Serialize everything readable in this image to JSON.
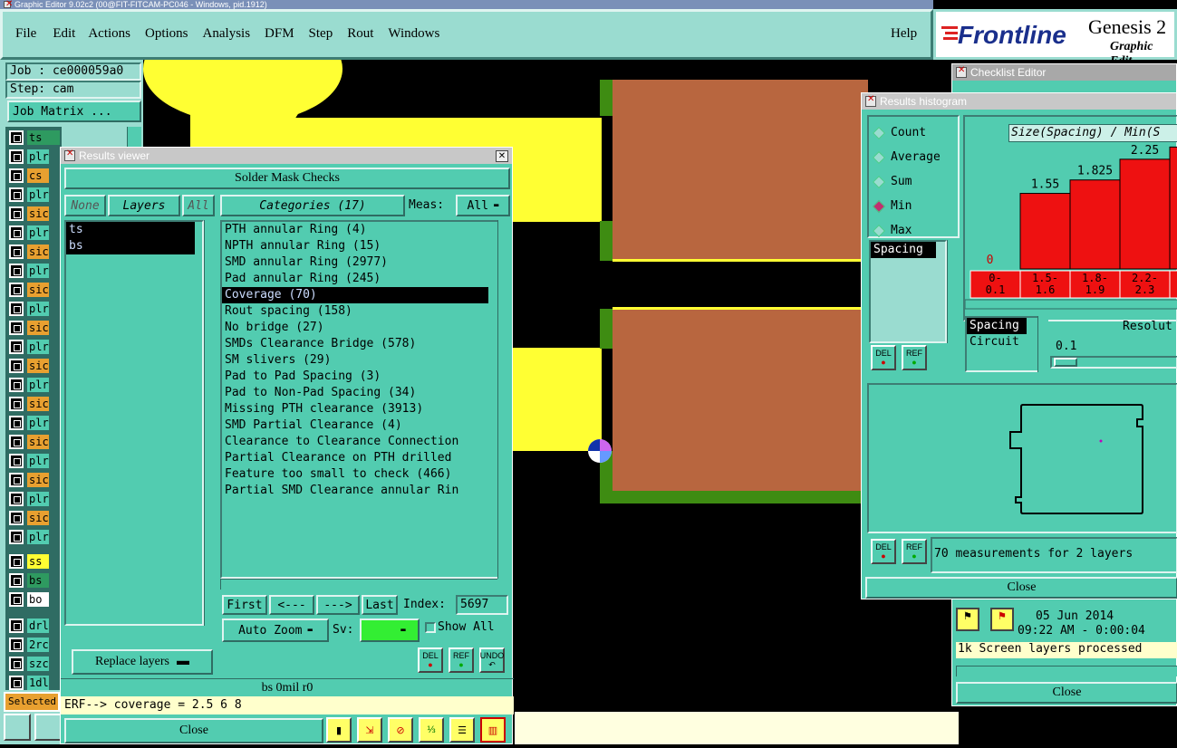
{
  "app": {
    "title": "Graphic Editor 9.02c2 (00@FIT-FITCAM-PC046 - Windows, pid.1912)",
    "brand": "Frontline",
    "brand_title": "Genesis 2",
    "brand_sub": "Graphic Edit"
  },
  "menu": [
    "File",
    "Edit",
    "Actions",
    "Options",
    "Analysis",
    "DFM",
    "Step",
    "Rout",
    "Windows"
  ],
  "help_label": "Help",
  "job": {
    "job_label": "Job : ce000059a0",
    "step_label": "Step: cam",
    "matrix_button": "Job Matrix ..."
  },
  "layers": [
    "ts",
    "plr",
    "cs",
    "plr",
    "sic",
    "plr",
    "sic",
    "plr",
    "sic",
    "plr",
    "sic",
    "plr",
    "sic",
    "plr",
    "sic",
    "plr",
    "sic",
    "plr",
    "sic",
    "plr",
    "sic",
    "plr",
    "ss",
    "bs",
    "bo",
    "drl",
    "2rc",
    "szc",
    "1dl"
  ],
  "selected_label": "Selected",
  "results_viewer": {
    "title": "Results viewer",
    "header": "Solder Mask Checks",
    "none_btn": "None",
    "layers_btn": "Layers",
    "all_btn": "All",
    "categories_btn": "Categories (17)",
    "meas_label": "Meas:",
    "meas_value": "All",
    "layer_list": [
      "ts",
      "bs"
    ],
    "categories": [
      "PTH annular Ring (4)",
      "NPTH annular Ring (15)",
      "SMD annular Ring (2977)",
      "Pad annular Ring (245)",
      "Coverage (70)",
      "Rout spacing (158)",
      "No bridge (27)",
      "SMDs Clearance Bridge (578)",
      "SM slivers (29)",
      "Pad to Pad Spacing (3)",
      "Pad to Non-Pad Spacing (34)",
      "Missing PTH clearance (3913)",
      "SMD Partial Clearance (4)",
      "Clearance to Clearance Connection",
      "Partial Clearance on PTH drilled",
      "Feature too small to check (466)",
      "Partial SMD Clearance annular Rin"
    ],
    "first": "First",
    "prev": "<---",
    "next": "--->",
    "last": "Last",
    "index_label": "Index:",
    "index_value": "5697",
    "auto_zoom": "Auto Zoom",
    "sv_label": "Sv:",
    "show_all": "Show All",
    "replace_layers": "Replace layers",
    "del": "DEL",
    "ref": "REF",
    "undo": "UNDO",
    "status": "bs 0mil  r0",
    "erf": "ERF--> coverage = 2.5 6 8",
    "close": "Close"
  },
  "checklist": {
    "title": "Checklist Editor",
    "date": "05 Jun 2014",
    "time": "09:22 AM - 0:00:04",
    "processed": "1k Screen layers processed",
    "close": "Close"
  },
  "histogram": {
    "title": "Results histogram",
    "options": [
      "Count",
      "Average",
      "Sum",
      "Min",
      "Max"
    ],
    "selected_option": "Min",
    "chart_title": "Size(Spacing) / Min(S",
    "spacing_list": [
      "Spacing"
    ],
    "res_list": [
      "Spacing",
      "Circuit"
    ],
    "resolution_label": "Resolut",
    "resolution_value": "0.1",
    "summary": "70 measurements for 2 layers",
    "close": "Close",
    "del": "DEL",
    "ref": "REF"
  },
  "chart_data": {
    "type": "bar",
    "title": "Size(Spacing) / Min(S",
    "categories": [
      "0-0.1",
      "1.5-1.6",
      "1.8-1.9",
      "2.2-2.3",
      ""
    ],
    "values": [
      0,
      1.55,
      1.825,
      2.25,
      2.5
    ],
    "data_labels": [
      "0",
      "1.55",
      "1.825",
      "2.25",
      ""
    ],
    "ylim": [
      0,
      2.6
    ],
    "bar_color": "#ee1111"
  },
  "colors": {
    "teal": "#52ccb0",
    "copper": "#b8663f",
    "yellow": "#ffff33",
    "green": "#3e8c12",
    "bar_red": "#ee1111"
  }
}
